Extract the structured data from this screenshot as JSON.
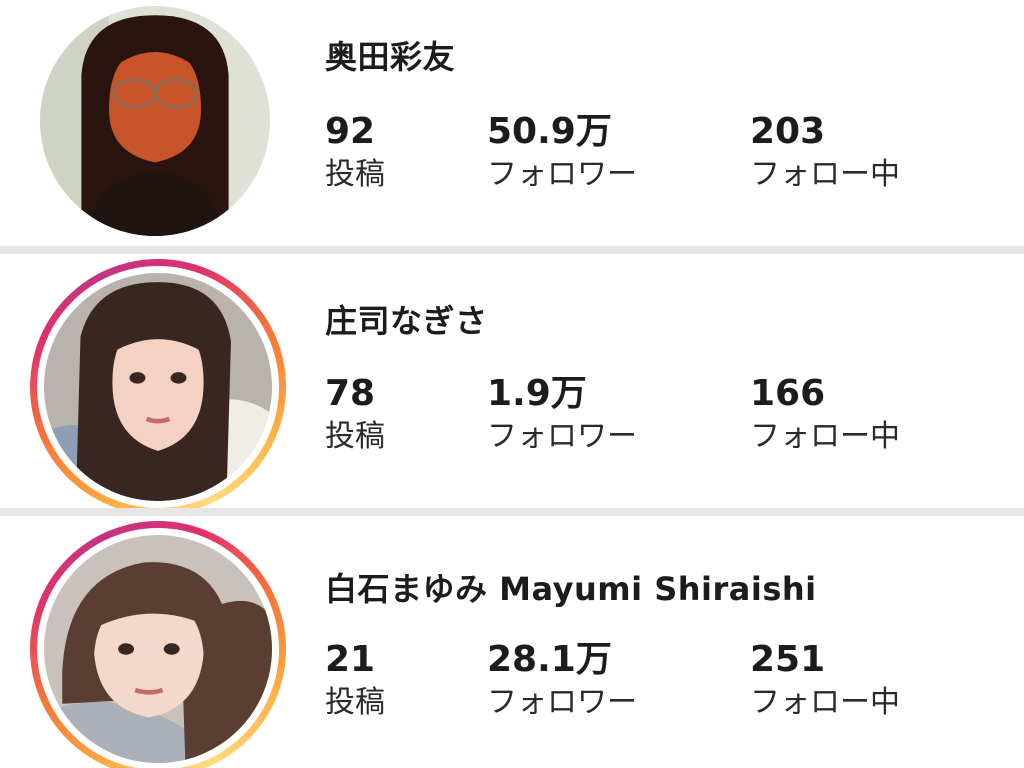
{
  "profiles": [
    {
      "name": "奥田彩友",
      "has_story_ring": false,
      "posts": "92",
      "posts_label": "投稿",
      "followers": "50.9万",
      "followers_label": "フォロワー",
      "following": "203",
      "following_label": "フォロー中"
    },
    {
      "name": "庄司なぎさ",
      "has_story_ring": true,
      "posts": "78",
      "posts_label": "投稿",
      "followers": "1.9万",
      "followers_label": "フォロワー",
      "following": "166",
      "following_label": "フォロー中"
    },
    {
      "name": "白石まゆみ Mayumi Shiraishi",
      "has_story_ring": true,
      "posts": "21",
      "posts_label": "投稿",
      "followers": "28.1万",
      "followers_label": "フォロワー",
      "following": "251",
      "following_label": "フォロー中"
    }
  ],
  "colors": {
    "ring_gradient": [
      "#fcaf45",
      "#f77737",
      "#e1306c",
      "#c13584"
    ],
    "divider": "#e6e6e6",
    "text": "#1c1c1c"
  }
}
